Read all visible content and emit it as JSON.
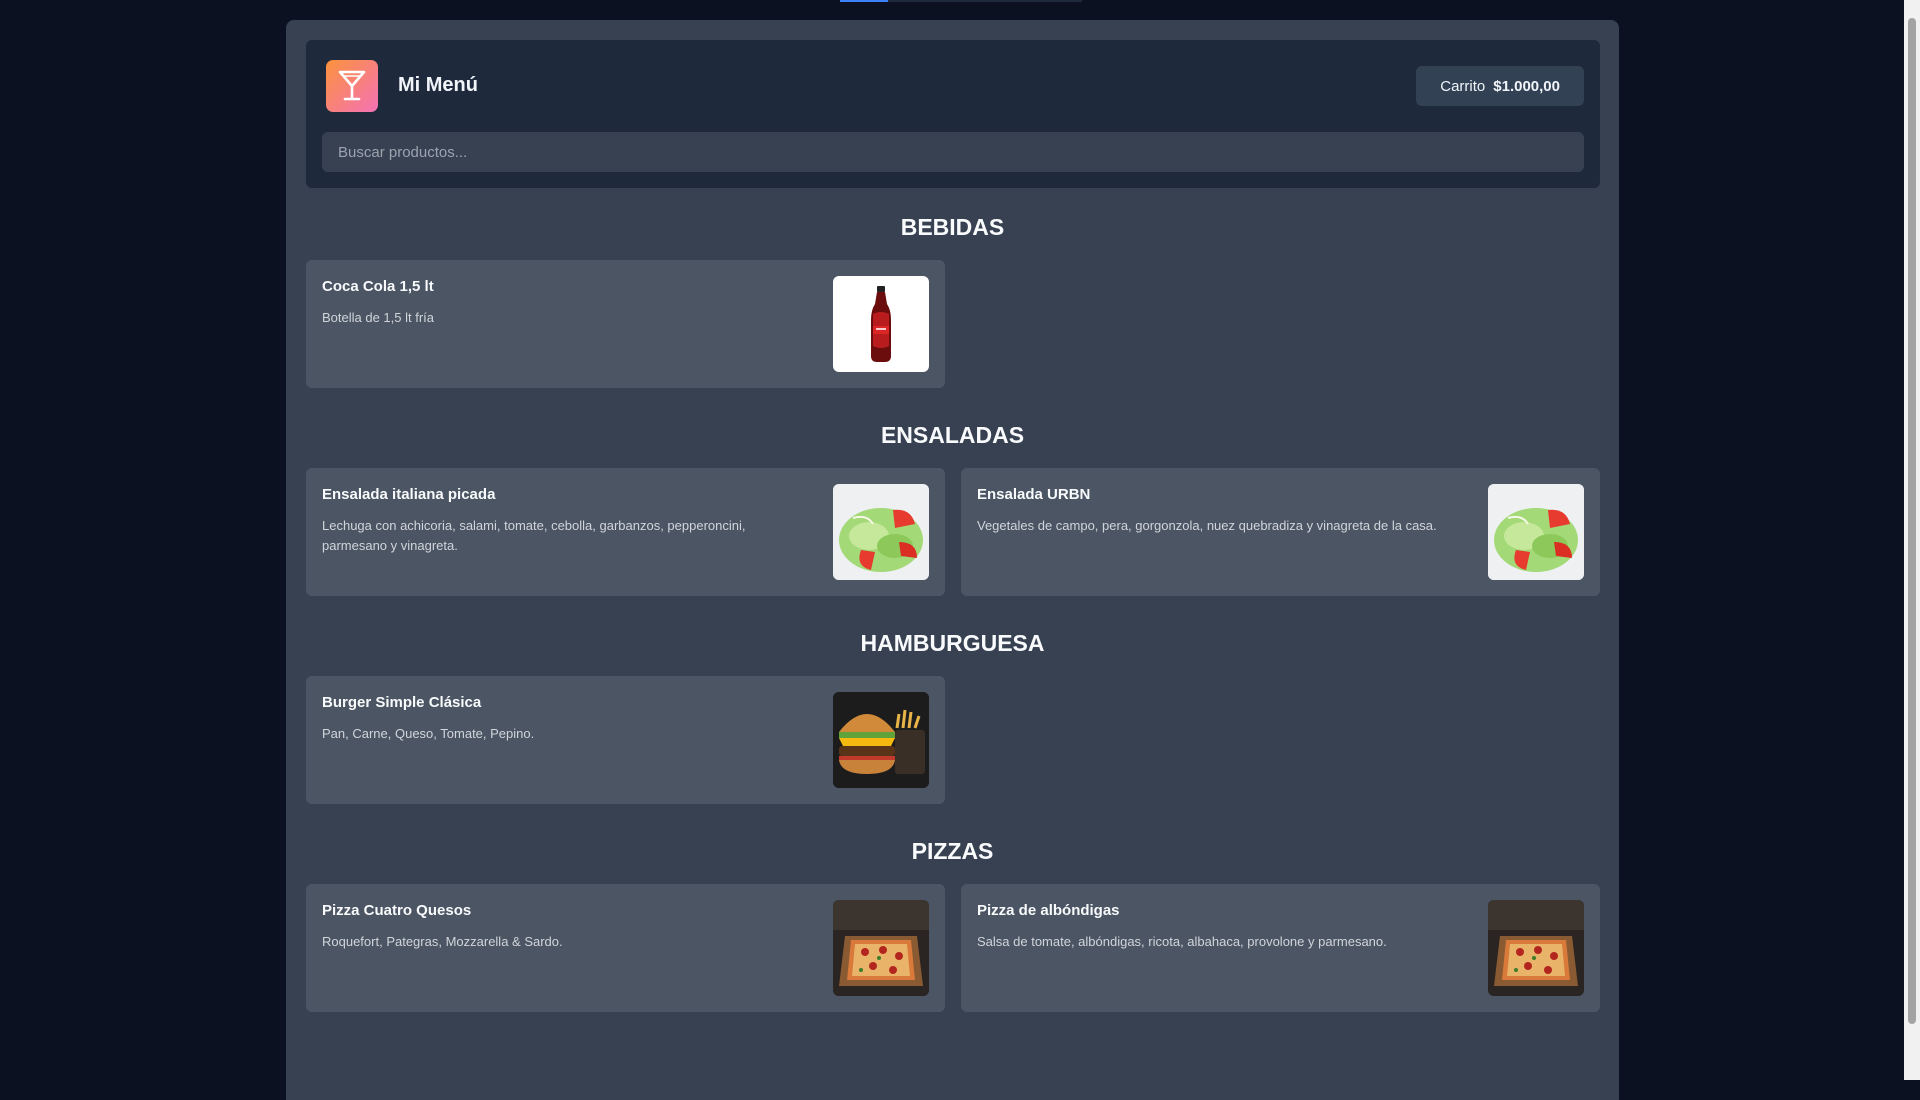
{
  "header": {
    "title": "Mi Menú",
    "cart_label": "Carrito",
    "cart_total": "$1.000,00",
    "logo_icon": "cocktail-icon",
    "brand_gradient": [
      "#fb923c",
      "#f472b6"
    ]
  },
  "search": {
    "placeholder": "Buscar productos..."
  },
  "sections": [
    {
      "title": "BEBIDAS",
      "items": [
        {
          "name": "Coca Cola 1,5 lt",
          "description": "Botella de 1,5 lt fría",
          "image": "coca-cola-bottle-image"
        }
      ]
    },
    {
      "title": "ENSALADAS",
      "items": [
        {
          "name": "Ensalada italiana picada",
          "description": "Lechuga con achicoria, salami, tomate, cebolla, garbanzos, pepperoncini, parmesano y vinagreta.",
          "image": "salad-image"
        },
        {
          "name": "Ensalada URBN",
          "description": "Vegetales de campo, pera, gorgonzola, nuez quebradiza y vinagreta de la casa.",
          "image": "salad-image"
        }
      ]
    },
    {
      "title": "HAMBURGUESA",
      "items": [
        {
          "name": "Burger Simple Clásica",
          "description": "Pan, Carne, Queso, Tomate, Pepino.",
          "image": "burger-image"
        }
      ]
    },
    {
      "title": "PIZZAS",
      "items": [
        {
          "name": "Pizza Cuatro Quesos",
          "description": "Roquefort, Pategras, Mozzarella & Sardo.",
          "image": "pizza-image"
        },
        {
          "name": "Pizza de albóndigas",
          "description": "Salsa de tomate, albóndigas, ricota, albahaca, provolone y parmesano.",
          "image": "pizza-image"
        }
      ]
    }
  ],
  "colors": {
    "background": "#0b1120",
    "page": "#374151",
    "header": "#1e293b",
    "card": "#4b5563",
    "accent": "#3b82f6"
  }
}
